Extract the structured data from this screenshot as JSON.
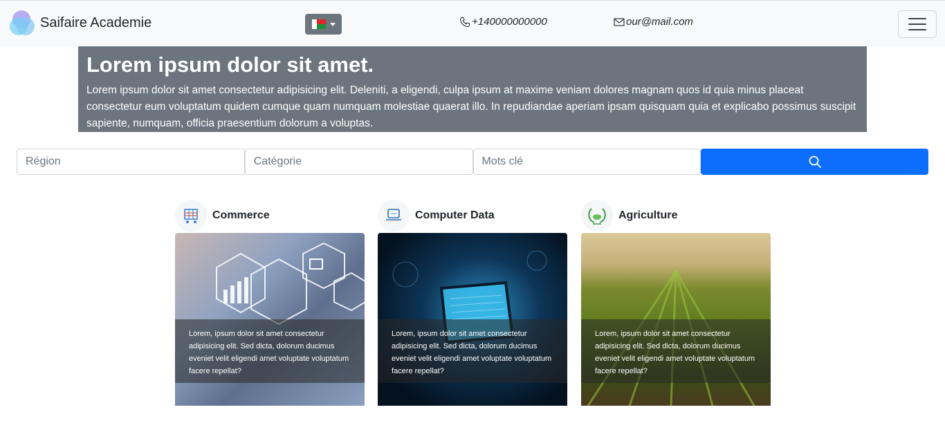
{
  "navbar": {
    "brand": "Saifaire Academie",
    "phone": "+140000000000",
    "email": "our@mail.com"
  },
  "hero": {
    "title": "Lorem ipsum dolor sit amet.",
    "text": "Lorem ipsum dolor sit amet consectetur adipisicing elit. Deleniti, a eligendi, culpa ipsum at maxime veniam dolores magnam quos id quia minus placeat consectetur eum voluptatum quidem cumque quam numquam molestiae quaerat illo. In repudiandae aperiam ipsam quisquam quia et explicabo possimus suscipit sapiente, numquam, officia praesentium dolorum a voluptas."
  },
  "search": {
    "region_placeholder": "Région",
    "category_placeholder": "Catégorie",
    "keywords_placeholder": "Mots clé"
  },
  "categories": [
    {
      "title": "Commerce",
      "icon": "cart-icon",
      "text": "Lorem, ipsum dolor sit amet consectetur adipisicing elit. Sed dicta, dolorum ducimus eveniet velit eligendi amet voluptate voluptatum facere repellat?"
    },
    {
      "title": "Computer Data",
      "icon": "computer-icon",
      "text": "Lorem, ipsum dolor sit amet consectetur adipisicing elit. Sed dicta, dolorum ducimus eveniet velit eligendi amet voluptate voluptatum facere repellat?"
    },
    {
      "title": "Agriculture",
      "icon": "wreath-icon",
      "text": "Lorem, ipsum dolor sit amet consectetur adipisicing elit. Sed dicta, dolorum ducimus eveniet velit eligendi amet voluptate voluptatum facere repellat?"
    }
  ],
  "colors": {
    "primary": "#0d6efd",
    "secondary": "#6c757d",
    "navbar_bg": "#f8f9fa"
  }
}
